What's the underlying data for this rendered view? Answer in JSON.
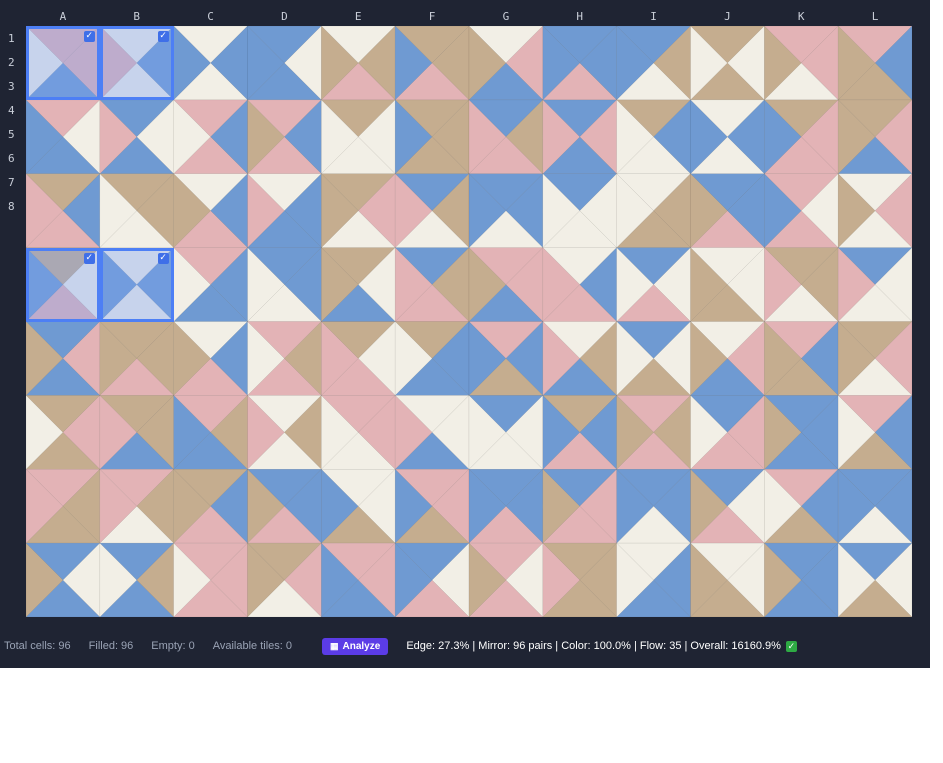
{
  "columns": [
    "A",
    "B",
    "C",
    "D",
    "E",
    "F",
    "G",
    "H",
    "I",
    "J",
    "K",
    "L"
  ],
  "rows": [
    "1",
    "2",
    "3",
    "4",
    "5",
    "6",
    "7",
    "8"
  ],
  "colors": {
    "blue": "#6f9ad2",
    "pink": "#e3b3b6",
    "tan": "#c5ad8f",
    "cream": "#f2efe6",
    "selection": "#4d7ff5"
  },
  "tiles": [
    [
      "ppbc",
      "cbcp",
      "cbcb",
      "bcbb",
      "ctpt",
      "ttpb",
      "cpbt",
      "bbpb",
      "btcb",
      "tctc",
      "ppct",
      "pbtt"
    ],
    [
      "pcbb",
      "bcbp",
      "pbpc",
      "pbpt",
      "tccc",
      "tttb",
      "btpp",
      "bpbp",
      "tbcc",
      "cbcb",
      "tppb",
      "tpbt"
    ],
    [
      "tbpp",
      "ttcc",
      "cbpt",
      "cbbp",
      "tpct",
      "btcp",
      "bbcb",
      "bccc",
      "cttc",
      "bbpt",
      "pcpb",
      "cpct"
    ],
    [
      "tcpb",
      "cbcb",
      "pbbc",
      "bbcc",
      "tcbt",
      "btpp",
      "ppbt",
      "cbpp",
      "bcpc",
      "cctt",
      "ttcp",
      "bccp"
    ],
    [
      "bpbt",
      "ttpt",
      "cbpt",
      "ptpc",
      "tcpp",
      "tbbc",
      "pbtb",
      "ctbp",
      "bctc",
      "cpbt",
      "pbtt",
      "tpct"
    ],
    [
      "tptc",
      "ttbp",
      "ptbb",
      "ctcp",
      "ppcc",
      "ccbp",
      "bccc",
      "tbpb",
      "ptpt",
      "bppc",
      "bbbt",
      "pbtc"
    ],
    [
      "pttp",
      "ptcp",
      "tbpt",
      "bbpt",
      "cctb",
      "pptb",
      "bbpb",
      "bppt",
      "bbcb",
      "bcpt",
      "pbtc",
      "bbcb"
    ],
    [
      "bcbt",
      "btbc",
      "pppc",
      "tpct",
      "ppbb",
      "bcpb",
      "pcpt",
      "tttp",
      "cbbc",
      "cctt",
      "bbbt",
      "bctc"
    ]
  ],
  "selected_cells": [
    "A1",
    "B1",
    "A4",
    "B4"
  ],
  "check_glyph": "✓",
  "stats": {
    "total_cells": "Total cells: 96",
    "filled": "Filled: 96",
    "empty": "Empty: 0",
    "available_tiles": "Available tiles: 0"
  },
  "analyze_button": {
    "icon": "bar-chart-icon",
    "glyph": "▦",
    "label": "Analyze"
  },
  "metrics_text": "Edge: 27.3% | Mirror: 96 pairs | Color: 100.0% | Flow: 35 | Overall: 16160.9%",
  "ok_glyph": "✓"
}
